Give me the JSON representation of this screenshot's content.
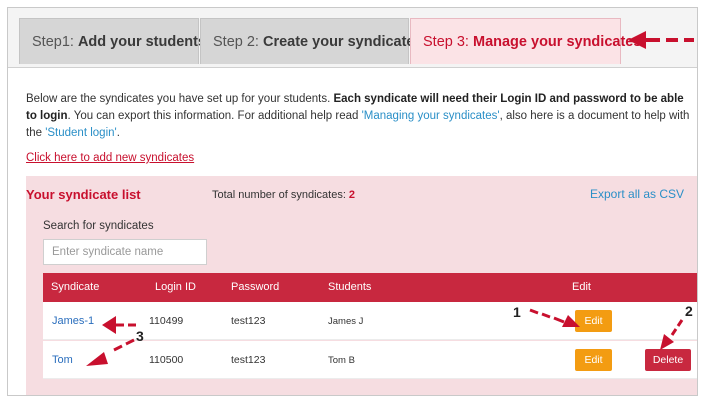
{
  "tabs": [
    {
      "step": "Step1:",
      "title": "Add your students",
      "dot": "•"
    },
    {
      "step": "Step 2:",
      "title": "Create your syndicates",
      "dot": "•"
    },
    {
      "step": "Step 3:",
      "title": "Manage your syndicates"
    }
  ],
  "intro": {
    "text1": "Below are the syndicates you have set up for your students. ",
    "bold": "Each syndicate will need their Login ID and password to be able to login",
    "text2": ". You can export this information. For additional help read ",
    "link1": "'Managing your syndicates'",
    "text3": ", also here is a document to help with the ",
    "link2": "'Student login'",
    "text4": "."
  },
  "add_link": "Click here to add new syndicates",
  "panel": {
    "title": "Your syndicate list",
    "total_label": "Total number of syndicates:",
    "total_count": "2",
    "export_label": "Export all as CSV",
    "search_label": "Search for syndicates",
    "search_placeholder": "Enter syndicate name"
  },
  "table": {
    "headers": {
      "syndicate": "Syndicate",
      "login": "Login ID",
      "password": "Password",
      "students": "Students",
      "edit": "Edit"
    },
    "rows": [
      {
        "name": "James-1",
        "login": "110499",
        "password": "test123",
        "students": "James J",
        "edit": "Edit",
        "delete": ""
      },
      {
        "name": "Tom",
        "login": "110500",
        "password": "test123",
        "students": "Tom B",
        "edit": "Edit",
        "delete": "Delete"
      }
    ]
  },
  "annotations": {
    "n1": "1",
    "n2": "2",
    "n3": "3"
  },
  "colors": {
    "accent_red": "#c8102e",
    "header_red": "#c8283f",
    "panel_pink": "#f6dde1",
    "edit_orange": "#f39c12",
    "link_blue": "#2a8fc7"
  }
}
